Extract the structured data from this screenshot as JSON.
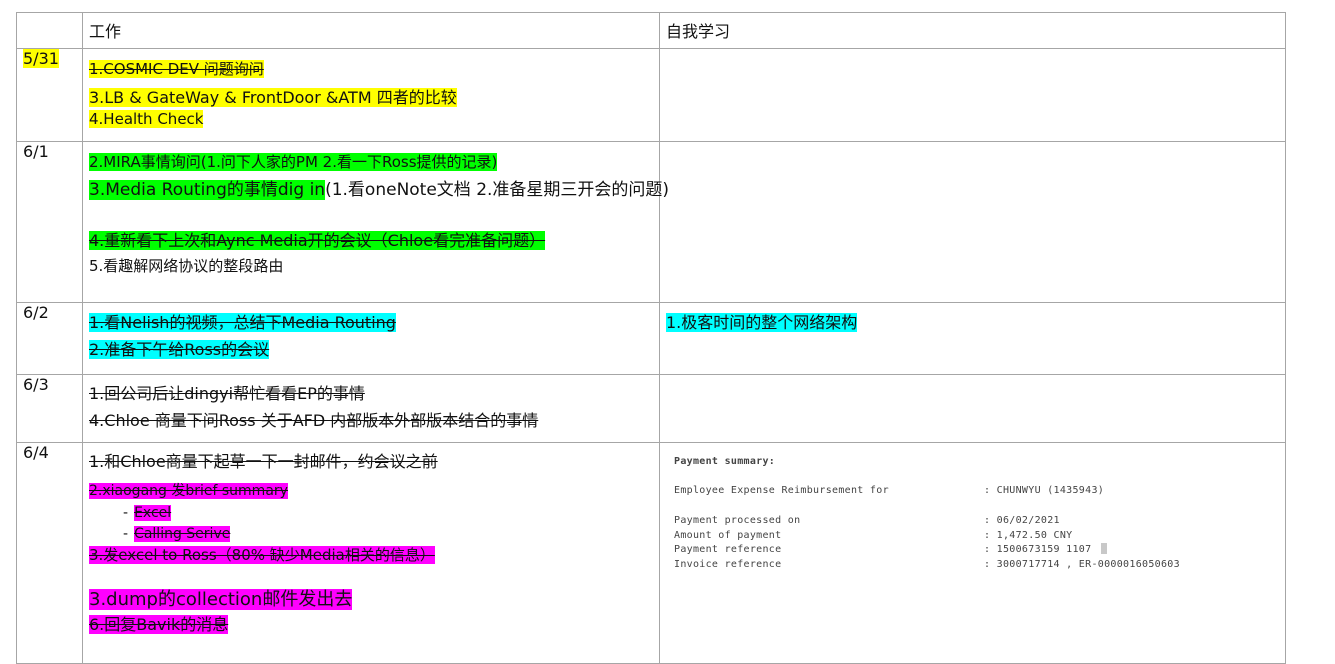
{
  "header": {
    "col_date": "",
    "col_work": "工作",
    "col_self": "自我学习"
  },
  "rows": [
    {
      "date": "5/31",
      "work": [
        "1.COSMIC DEV 问题询问",
        "3.LB & GateWay & FrontDoor &ATM 四者的比较",
        "4.Health Check"
      ],
      "self": ""
    },
    {
      "date": "6/1",
      "work": [
        "2.MIRA事情询问(1.问下人家的PM 2.看一下Ross提供的记录)",
        "3.Media Routing的事情dig in",
        "(1.看oneNote文档 2.准备星期三开会的问题)",
        "4.重新看下上次和Aync Media开的会议（Chloe看完准备问题）",
        "5.看趣解网络协议的整段路由"
      ],
      "self": ""
    },
    {
      "date": "6/2",
      "work": [
        "1.看Nelish的视频，总结下Media Routing",
        "2.准备下午给Ross的会议"
      ],
      "self": "1.极客时间的整个网络架构"
    },
    {
      "date": "6/3",
      "work": [
        "1.回公司后让dingyi帮忙看看EP的事情",
        "4.Chloe 商量下问Ross 关于AFD 内部版本外部版本结合的事情"
      ],
      "self": ""
    },
    {
      "date": "6/4",
      "work": [
        "1.和Chloe商量下起草一下一封邮件，约会议之前",
        "2.xiaogang 发brief summary",
        "Excel",
        "Calling Serive",
        "3.发excel to Ross（80% 缺少Media相关的信息）",
        "3.dump的collection邮件发出去",
        "6.回复Bavik的消息"
      ],
      "self": ""
    }
  ],
  "payment": {
    "title": "Payment summary:",
    "line1_key": "Employee Expense Reimbursement for",
    "line1_val": ": CHUNWYU (1435943)",
    "processed_key": "Payment processed on",
    "processed_val": ": 06/02/2021",
    "amount_key": "Amount of payment",
    "amount_val": ": 1,472.50 CNY",
    "reference_key": "Payment reference",
    "reference_val": ": 1500673159   1107",
    "invoice_key": "Invoice reference",
    "invoice_val": ": 3000717714 , ER-0000016050603"
  },
  "dash": "-",
  "colors": {
    "yellow": "#ffff00",
    "green": "#00ff00",
    "cyan": "#00ffff",
    "magenta": "#ff00ff",
    "border": "#a6a6a6"
  }
}
